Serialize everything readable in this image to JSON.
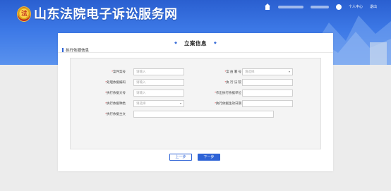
{
  "header": {
    "emblem_text": "法",
    "site_title": "山东法院电子诉讼服务网",
    "nav": {
      "user_center": "个人中心",
      "exit": "退出"
    }
  },
  "panel": {
    "title": "立案信息",
    "section_label": "执行依据信息"
  },
  "form": {
    "rows": [
      {
        "left": {
          "label": "案件案号",
          "placeholder": "请输入",
          "required": true
        },
        "right": {
          "label": "案 由 署 号",
          "placeholder": "请选择",
          "required": true,
          "select": true
        }
      },
      {
        "left": {
          "label": "处理依据编码",
          "placeholder": "请输入",
          "required": true
        },
        "right": {
          "label": "执 行 法 院",
          "placeholder": "",
          "required": true
        }
      },
      {
        "left": {
          "label": "执行依据文号",
          "placeholder": "请输入",
          "required": true
        },
        "right": {
          "label": "作出执行依据单位",
          "placeholder": "",
          "required": true
        }
      },
      {
        "left": {
          "label": "执行依据种类",
          "placeholder": "请选择",
          "required": true,
          "select": true
        },
        "right": {
          "label": "执行依据生效日期",
          "placeholder": "",
          "required": true
        }
      }
    ],
    "content": {
      "label": "执行依据主文",
      "required": true
    }
  },
  "buttons": {
    "prev": "上一步",
    "next": "下一步"
  },
  "colors": {
    "accent": "#2e63d6",
    "required": "#e03030",
    "header": "#3c78e6"
  }
}
